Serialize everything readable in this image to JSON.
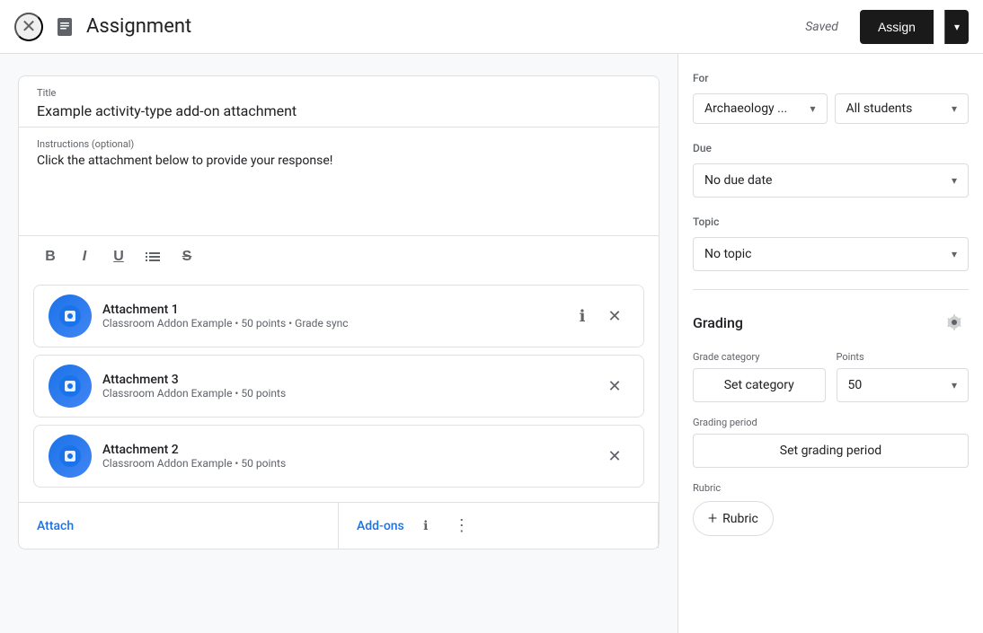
{
  "header": {
    "title": "Assignment",
    "saved_label": "Saved",
    "assign_label": "Assign"
  },
  "left": {
    "title_label": "Title",
    "title_value": "Example activity-type add-on attachment",
    "instructions_label": "Instructions (optional)",
    "instructions_value": "Click the attachment below to provide your response!",
    "toolbar": {
      "bold": "B",
      "italic": "I",
      "underline": "U",
      "list": "☰",
      "strikethrough": "S̶"
    },
    "attachments": [
      {
        "name": "Attachment 1",
        "sub": "Classroom Addon Example • 50 points • Grade sync"
      },
      {
        "name": "Attachment 3",
        "sub": "Classroom Addon Example • 50 points"
      },
      {
        "name": "Attachment 2",
        "sub": "Classroom Addon Example • 50 points"
      }
    ],
    "bottom_attach": "Attach",
    "bottom_addons": "Add-ons"
  },
  "right": {
    "for_label": "For",
    "class_value": "Archaeology ...",
    "students_value": "All students",
    "due_label": "Due",
    "due_value": "No due date",
    "topic_label": "Topic",
    "topic_value": "No topic",
    "grading_title": "Grading",
    "grade_category_label": "Grade category",
    "set_category_label": "Set category",
    "points_label": "Points",
    "points_value": "50",
    "grading_period_label": "Grading period",
    "set_grading_period_label": "Set grading period",
    "rubric_label": "Rubric",
    "add_rubric_label": "Rubric"
  }
}
